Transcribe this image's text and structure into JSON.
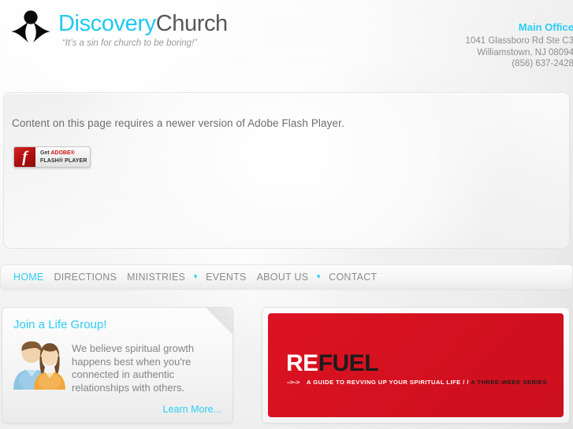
{
  "header": {
    "logo": {
      "icon": "person-logo-icon",
      "word_primary": "Discovery",
      "word_secondary": "Church",
      "tagline": "“It’s a sin for church to be boring!”"
    },
    "contact": {
      "title": "Main Office",
      "address_line1": "1041 Glassboro Rd Ste C3",
      "address_line2": "Williamstown, NJ 08094",
      "phone": "(856) 637-2428"
    }
  },
  "flash": {
    "message": "Content on this page requires a newer version of Adobe Flash Player.",
    "badge": {
      "icon": "adobe-flash-icon",
      "line1_get": "Get ",
      "line1_adobe": "ADOBE®",
      "line2": "FLASH® PLAYER",
      "download_icon": "⬇"
    }
  },
  "nav": {
    "items": [
      {
        "label": "HOME",
        "active": true,
        "caret": false
      },
      {
        "label": "DIRECTIONS",
        "active": false,
        "caret": false
      },
      {
        "label": "MINISTRIES",
        "active": false,
        "caret": true
      },
      {
        "label": "EVENTS",
        "active": false,
        "caret": false
      },
      {
        "label": "ABOUT US",
        "active": false,
        "caret": true
      },
      {
        "label": "CONTACT",
        "active": false,
        "caret": false
      }
    ],
    "caret_glyph": "▼"
  },
  "promo": {
    "title": "Join a Life Group!",
    "avatar_icon": "two-people-icon",
    "body": "We believe spiritual growth happens best when you're connected in authentic relationships with others.",
    "link": "Learn More..."
  },
  "banner": {
    "title_light": "RE",
    "title_dark": "FUEL",
    "sub_arrows": "-->-->",
    "sub_light": "A GUIDE TO REVVING UP YOUR SPIRITUAL LIFE / /",
    "sub_dark": "A THREE-WEEK SERIES"
  },
  "colors": {
    "accent_cyan": "#2ccdf4",
    "banner_red": "#d51120",
    "body_gray": "#858585",
    "nav_gray": "#8b8b8b"
  }
}
